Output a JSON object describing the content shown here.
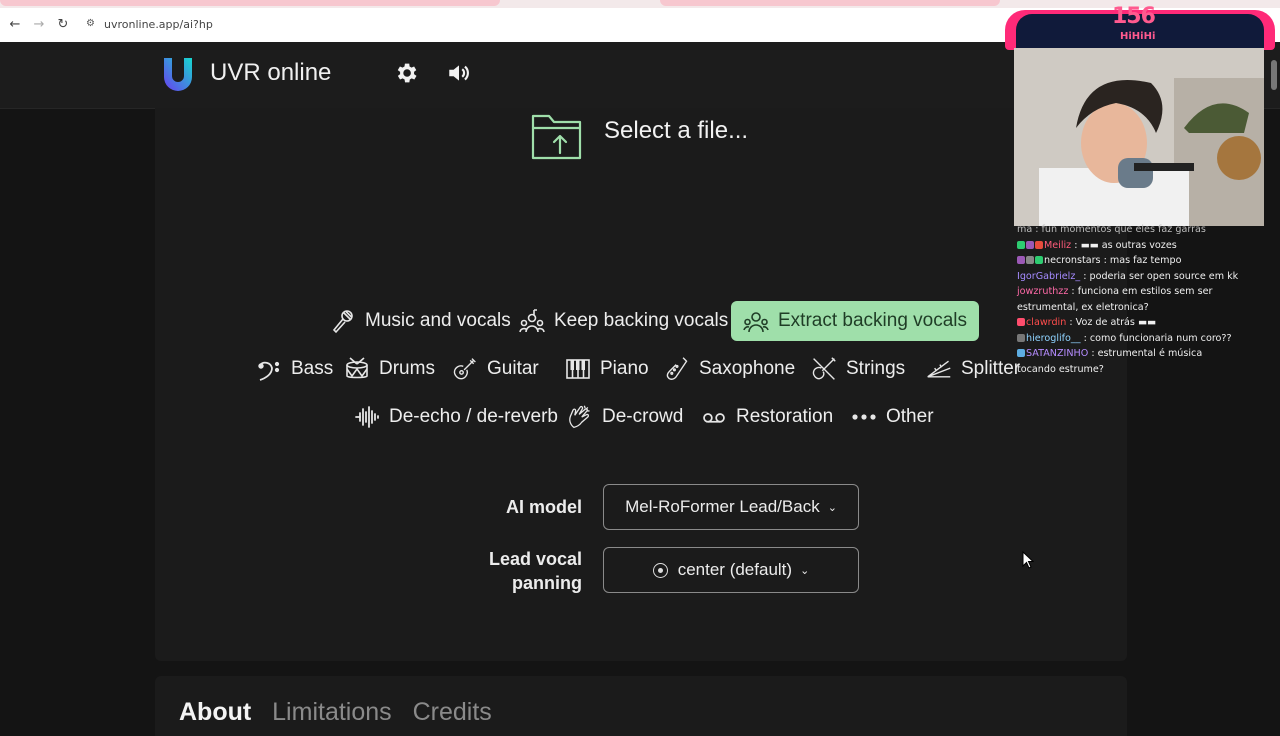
{
  "browser": {
    "url": "uvronline.app/ai?hp",
    "back_icon": "arrow-left-icon",
    "forward_icon": "arrow-right-icon",
    "reload_icon": "reload-icon"
  },
  "header": {
    "app_name": "UVR online",
    "settings_icon": "gear-icon",
    "sound_icon": "speaker-icon"
  },
  "upload": {
    "label": "Select a file..."
  },
  "modes": {
    "row1": [
      {
        "label": "Music and vocals",
        "icon": "microphone-icon",
        "active": false
      },
      {
        "label": "Keep backing vocals",
        "icon": "singers-icon",
        "active": false
      },
      {
        "label": "Extract backing vocals",
        "icon": "singers-icon",
        "active": true
      }
    ],
    "row2": [
      {
        "label": "Bass",
        "icon": "bass-clef-icon"
      },
      {
        "label": "Drums",
        "icon": "drum-icon"
      },
      {
        "label": "Guitar",
        "icon": "guitar-icon"
      },
      {
        "label": "Piano",
        "icon": "piano-icon"
      },
      {
        "label": "Saxophone",
        "icon": "saxophone-icon"
      },
      {
        "label": "Strings",
        "icon": "violin-icon"
      },
      {
        "label": "Splitter",
        "icon": "split-icon"
      }
    ],
    "row3": [
      {
        "label": "De-echo / de-reverb",
        "icon": "waveform-icon"
      },
      {
        "label": "De-crowd",
        "icon": "clap-icon"
      },
      {
        "label": "Restoration",
        "icon": "cassette-icon"
      },
      {
        "label": "Other",
        "icon": "dots-icon"
      }
    ]
  },
  "settings": {
    "model_label": "AI model",
    "model_value": "Mel-RoFormer Lead/Back",
    "panning_label_1": "Lead vocal",
    "panning_label_2": "panning",
    "panning_value": "center (default)"
  },
  "bottom_tabs": [
    "About",
    "Limitations",
    "Credits"
  ],
  "stream": {
    "viewer_count": "156",
    "viewer_label": "HiHiHi",
    "chat": [
      {
        "user": "",
        "text": "ma : fun momentos que eles faz garras",
        "color": "#cfcfcf"
      },
      {
        "user": "Meiliz",
        "text": ": ▬▬ as outras vozes",
        "color": "#ff5b7a"
      },
      {
        "user": "necronstars",
        "text": ": mas faz tempo",
        "color": "#ffffff"
      },
      {
        "user": "IgorGabrielz_",
        "text": ": poderia ser open source em kk",
        "color": "#a58bff"
      },
      {
        "user": "jowzruthzz",
        "text": ": funciona em estilos sem ser",
        "color": "#ff6aa8"
      },
      {
        "user": "",
        "text": "estrumental, ex eletronica?",
        "color": "#ffffff"
      },
      {
        "user": "clawrdin",
        "text": ": Voz de atrás ▬▬",
        "color": "#ff4d4d"
      },
      {
        "user": "hieroglifo__",
        "text": ": como funcionaria num coro??",
        "color": "#8fd3ff"
      },
      {
        "user": "SATANZINHO",
        "text": ": estrumental é música",
        "color": "#b58cff"
      },
      {
        "user": "",
        "text": "tocando estrume?",
        "color": "#ffffff"
      }
    ]
  },
  "colors": {
    "accent_green": "#9fdfaa",
    "logo_gradient_start": "#6a3df0",
    "logo_gradient_end": "#16d8d0",
    "stream_pink": "#ff2a78"
  }
}
